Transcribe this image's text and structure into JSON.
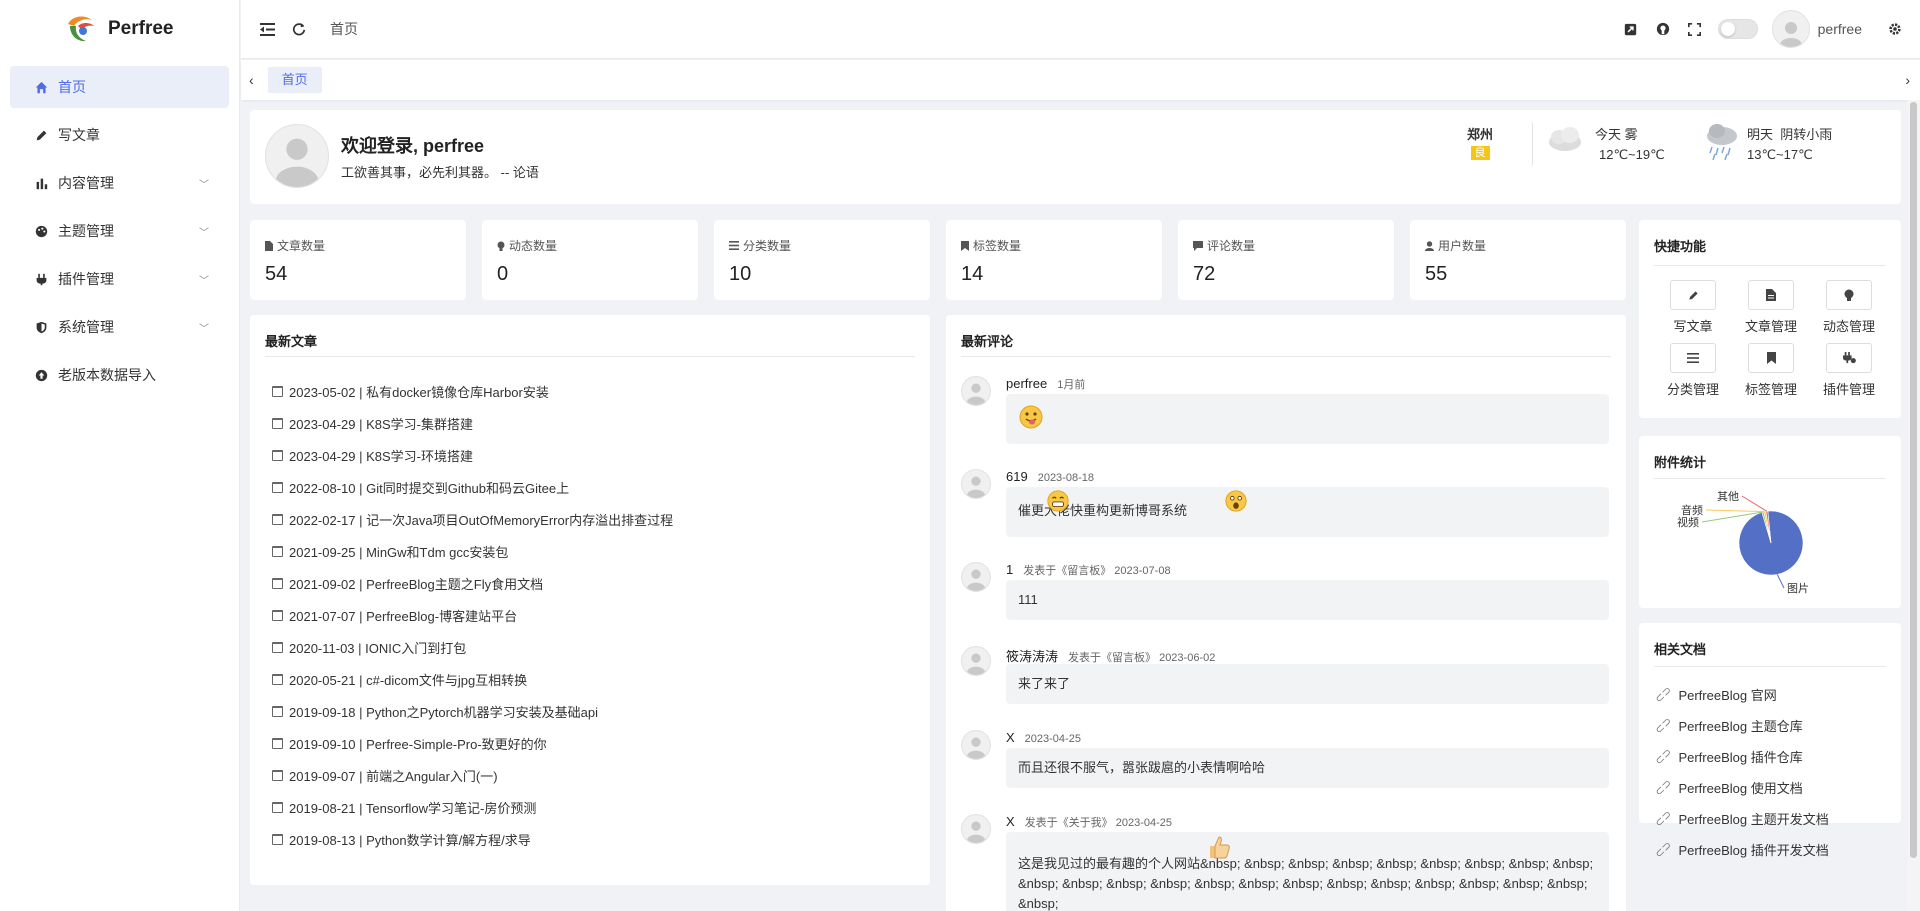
{
  "app": {
    "name": "Perfree"
  },
  "sidebar": {
    "items": [
      {
        "label": "首页",
        "active": true
      },
      {
        "label": "写文章"
      },
      {
        "label": "内容管理",
        "expandable": true
      },
      {
        "label": "主题管理",
        "expandable": true
      },
      {
        "label": "插件管理",
        "expandable": true
      },
      {
        "label": "系统管理",
        "expandable": true
      },
      {
        "label": "老版本数据导入"
      }
    ]
  },
  "topbar": {
    "breadcrumb": "首页",
    "username": "perfree"
  },
  "tabs": [
    {
      "label": "首页"
    }
  ],
  "welcome": {
    "title": "欢迎登录, perfree",
    "motto": "工欲善其事，必先利其器。 -- 论语",
    "city": "郑州",
    "aqi": "良",
    "today": {
      "label": "今天",
      "weather": "雾",
      "temp": "12℃~19℃"
    },
    "tomorrow": {
      "label": "明天",
      "weather": "阴转小雨",
      "temp": "13℃~17℃"
    }
  },
  "stats": [
    {
      "label": "文章数量",
      "value": "54",
      "icon": "file-icon"
    },
    {
      "label": "动态数量",
      "value": "0",
      "icon": "bulb-icon"
    },
    {
      "label": "分类数量",
      "value": "10",
      "icon": "list-icon"
    },
    {
      "label": "标签数量",
      "value": "14",
      "icon": "bookmark-icon"
    },
    {
      "label": "评论数量",
      "value": "72",
      "icon": "comment-icon"
    },
    {
      "label": "用户数量",
      "value": "55",
      "icon": "user-icon"
    }
  ],
  "latest_articles": {
    "title": "最新文章",
    "items": [
      "2023-05-02 | 私有docker镜像仓库Harbor安装",
      "2023-04-29 | K8S学习-集群搭建",
      "2023-04-29 | K8S学习-环境搭建",
      "2022-08-10 | Git同时提交到Github和码云Gitee上",
      "2022-02-17 | 记一次Java项目OutOfMemoryError内存溢出排查过程",
      "2021-09-25 | MinGw和Tdm gcc安装包",
      "2021-09-02 | PerfreeBlog主题之Fly食用文档",
      "2021-07-07 | PerfreeBlog-博客建站平台",
      "2020-11-03 | IONIC入门到打包",
      "2020-05-21 | c#-dicom文件与jpg互相转换",
      "2019-09-18 | Python之Pytorch机器学习安装及基础api",
      "2019-09-10 | Perfree-Simple-Pro-致更好的你",
      "2019-09-07 | 前端之Angular入门(一)",
      "2019-08-21 | Tensorflow学习笔记-房价预测",
      "2019-08-13 | Python数学计算/解方程/求导"
    ]
  },
  "latest_comments": {
    "title": "最新评论",
    "items": [
      {
        "author": "perfree",
        "meta": "1月前",
        "text": ""
      },
      {
        "author": "619",
        "meta": "2023-08-18",
        "text": "催更大佬快重构更新博哥系统"
      },
      {
        "author": "1",
        "meta": "发表于《留言板》 2023-07-08",
        "text": "111"
      },
      {
        "author": "筱涛涛涛",
        "meta": "发表于《留言板》 2023-06-02",
        "text": "来了来了"
      },
      {
        "author": "X",
        "meta": "2023-04-25",
        "text": "而且还很不服气，嚣张跋扈的小表情啊哈哈"
      },
      {
        "author": "X",
        "meta": "发表于《关于我》 2023-04-25",
        "text": "这是我见过的最有趣的个人网站&nbsp; &nbsp; &nbsp; &nbsp; &nbsp; &nbsp; &nbsp; &nbsp; &nbsp; &nbsp; &nbsp; &nbsp; &nbsp; &nbsp; &nbsp; &nbsp; &nbsp; &nbsp; &nbsp; &nbsp; &nbsp; &nbsp; &nbsp;"
      }
    ]
  },
  "quick": {
    "title": "快捷功能",
    "items": [
      {
        "label": "写文章",
        "icon": "pencil-icon"
      },
      {
        "label": "文章管理",
        "icon": "file-icon"
      },
      {
        "label": "动态管理",
        "icon": "bulb-icon"
      },
      {
        "label": "分类管理",
        "icon": "list-icon"
      },
      {
        "label": "标签管理",
        "icon": "bookmark-icon"
      },
      {
        "label": "插件管理",
        "icon": "plug-icon"
      }
    ]
  },
  "attachments": {
    "title": "附件统计",
    "chart_data": {
      "type": "pie",
      "categories": [
        "图片",
        "视频",
        "音频",
        "其他"
      ],
      "values": [
        97,
        1,
        1,
        1
      ],
      "colors": [
        "#5470c6",
        "#91cc75",
        "#fac858",
        "#ee6666"
      ]
    }
  },
  "docs": {
    "title": "相关文档",
    "items": [
      "PerfreeBlog 官网",
      "PerfreeBlog 主题仓库",
      "PerfreeBlog 插件仓库",
      "PerfreeBlog 使用文档",
      "PerfreeBlog 主题开发文档",
      "PerfreeBlog 插件开发文档"
    ]
  }
}
